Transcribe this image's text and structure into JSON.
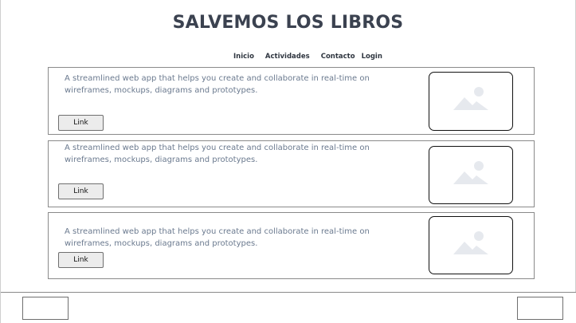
{
  "header": {
    "title": "SALVEMOS LOS LIBROS",
    "nav": [
      "Inicio",
      "Actividades",
      "Contacto",
      "Login"
    ]
  },
  "cards": [
    {
      "text": "A streamlined web app that helps you create and collaborate in real-time on wireframes, mockups, diagrams and prototypes.",
      "button_label": "Link",
      "image_icon": "image-placeholder-icon"
    },
    {
      "text": "A streamlined web app that helps you create and collaborate in real-time on wireframes, mockups, diagrams and prototypes.",
      "button_label": "Link",
      "image_icon": "image-placeholder-icon"
    },
    {
      "text": "A streamlined web app that helps you create and collaborate in real-time on wireframes, mockups, diagrams and prototypes.",
      "button_label": "Link",
      "image_icon": "image-placeholder-icon"
    }
  ],
  "colors": {
    "title": "#3b4250",
    "body_text": "#6b7a8f",
    "border": "#8a8a8a",
    "placeholder_icon": "#e6e9ee"
  }
}
